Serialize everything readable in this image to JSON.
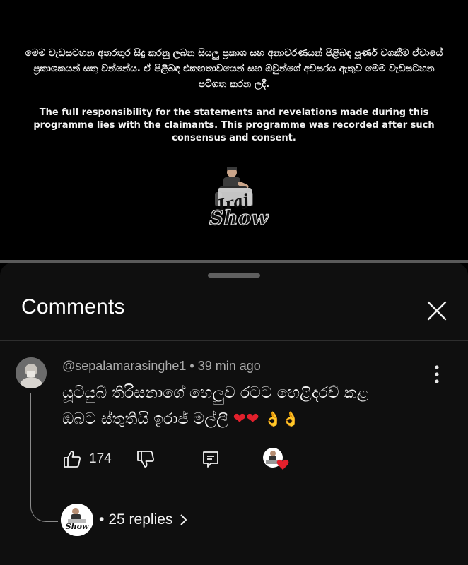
{
  "video": {
    "disclaimer_si": "මෙම වැඩසටහන අතරතුර සිදු කරනු ලබන සියලු ප්‍රකාශ සහ අනාවරණයන් පිළිබඳ පූර්ණ වගකීම ඒවායේ ප්‍රකාශකයන් සතු වන්නේය. ඒ පිළිබඳ එකඟතාවයෙන් සහ ඔවුන්ගේ අවසරය ඇතුව මෙම වැඩසටහන පටිගත කරන ලදී.",
    "disclaimer_en": "The full responsibility for the statements and revelations made during this programme lies with the claimants. This programme was recorded after such consensus and consent.",
    "logo_text_top": "Iraj",
    "logo_text_bottom": "Show",
    "progress_fraction": 0.0
  },
  "comments_panel": {
    "title": "Comments",
    "close_icon": "close-icon"
  },
  "comment": {
    "author": "@sepalamarasinghe1",
    "time": "39 min ago",
    "text_line1": "යූටියුබ් තිරිසනාගේ හෙලුව රටට හෙළිදරව් කළ",
    "text_line2": "ඔබට ස්තුතියි ඉරාජ් මල්ලී",
    "hearts": "❤❤",
    "ok_hands": "👌👌",
    "like_count": "174",
    "replies_label": "25 replies",
    "accent_heart": "#e2202c"
  }
}
